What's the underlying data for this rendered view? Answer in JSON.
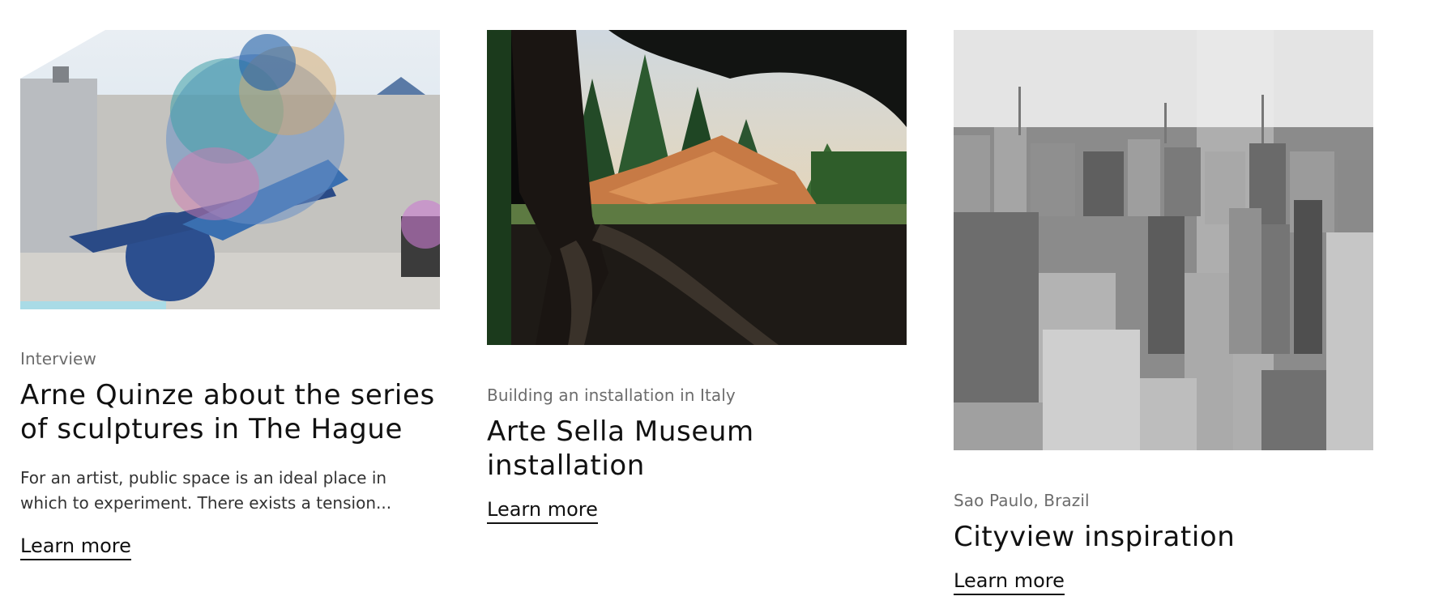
{
  "cards": [
    {
      "category": "Interview",
      "title": "Arne Quinze about the series of sculptures in The Hague",
      "excerpt": "For an artist, public space is an ideal place in which to experiment. There exists a tension...",
      "link_label": "Learn more"
    },
    {
      "category": "Building an installation in Italy",
      "title": "Arte Sella Museum installation",
      "link_label": "Learn more"
    },
    {
      "category": "Sao Paulo, Brazil",
      "title": "Cityview inspiration",
      "link_label": "Learn more"
    }
  ]
}
